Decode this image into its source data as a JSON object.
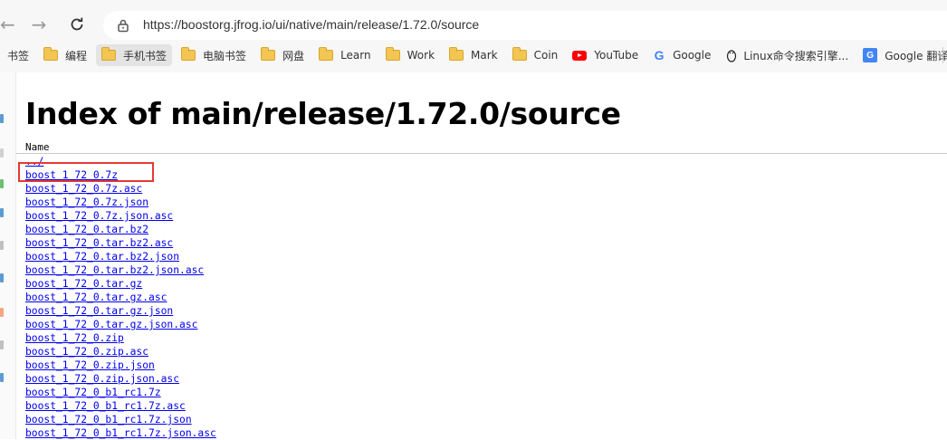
{
  "browser": {
    "url": "https://boostorg.jfrog.io/ui/native/main/release/1.72.0/source",
    "bookmarks": [
      {
        "label": "书签",
        "icon": "none"
      },
      {
        "label": "编程",
        "icon": "folder-icon"
      },
      {
        "label": "手机书签",
        "icon": "folder-icon"
      },
      {
        "label": "电脑书签",
        "icon": "folder-icon"
      },
      {
        "label": "网盘",
        "icon": "folder-icon"
      },
      {
        "label": "Learn",
        "icon": "folder-icon"
      },
      {
        "label": "Work",
        "icon": "folder-icon"
      },
      {
        "label": "Mark",
        "icon": "folder-icon"
      },
      {
        "label": "Coin",
        "icon": "folder-icon"
      },
      {
        "label": "YouTube",
        "icon": "youtube-icon"
      },
      {
        "label": "Google",
        "icon": "google-icon"
      },
      {
        "label": "Linux命令搜索引擎...",
        "icon": "linux-icon"
      },
      {
        "label": "Google 翻译",
        "icon": "google-translate-icon"
      }
    ]
  },
  "page": {
    "title": "Index of main/release/1.72.0/source",
    "column_header": "Name",
    "files": [
      "../",
      "boost_1_72_0.7z",
      "boost_1_72_0.7z.asc",
      "boost_1_72_0.7z.json",
      "boost_1_72_0.7z.json.asc",
      "boost_1_72_0.tar.bz2",
      "boost_1_72_0.tar.bz2.asc",
      "boost_1_72_0.tar.bz2.json",
      "boost_1_72_0.tar.bz2.json.asc",
      "boost_1_72_0.tar.gz",
      "boost_1_72_0.tar.gz.asc",
      "boost_1_72_0.tar.gz.json",
      "boost_1_72_0.tar.gz.json.asc",
      "boost_1_72_0.zip",
      "boost_1_72_0.zip.asc",
      "boost_1_72_0.zip.json",
      "boost_1_72_0.zip.json.asc",
      "boost_1_72_0_b1_rc1.7z",
      "boost_1_72_0_b1_rc1.7z.asc",
      "boost_1_72_0_b1_rc1.7z.json",
      "boost_1_72_0_b1_rc1.7z.json.asc"
    ],
    "highlighted_file": "boost_1_72_0.7z"
  },
  "colors": {
    "link": "#0000ee",
    "highlight": "#e53935"
  }
}
